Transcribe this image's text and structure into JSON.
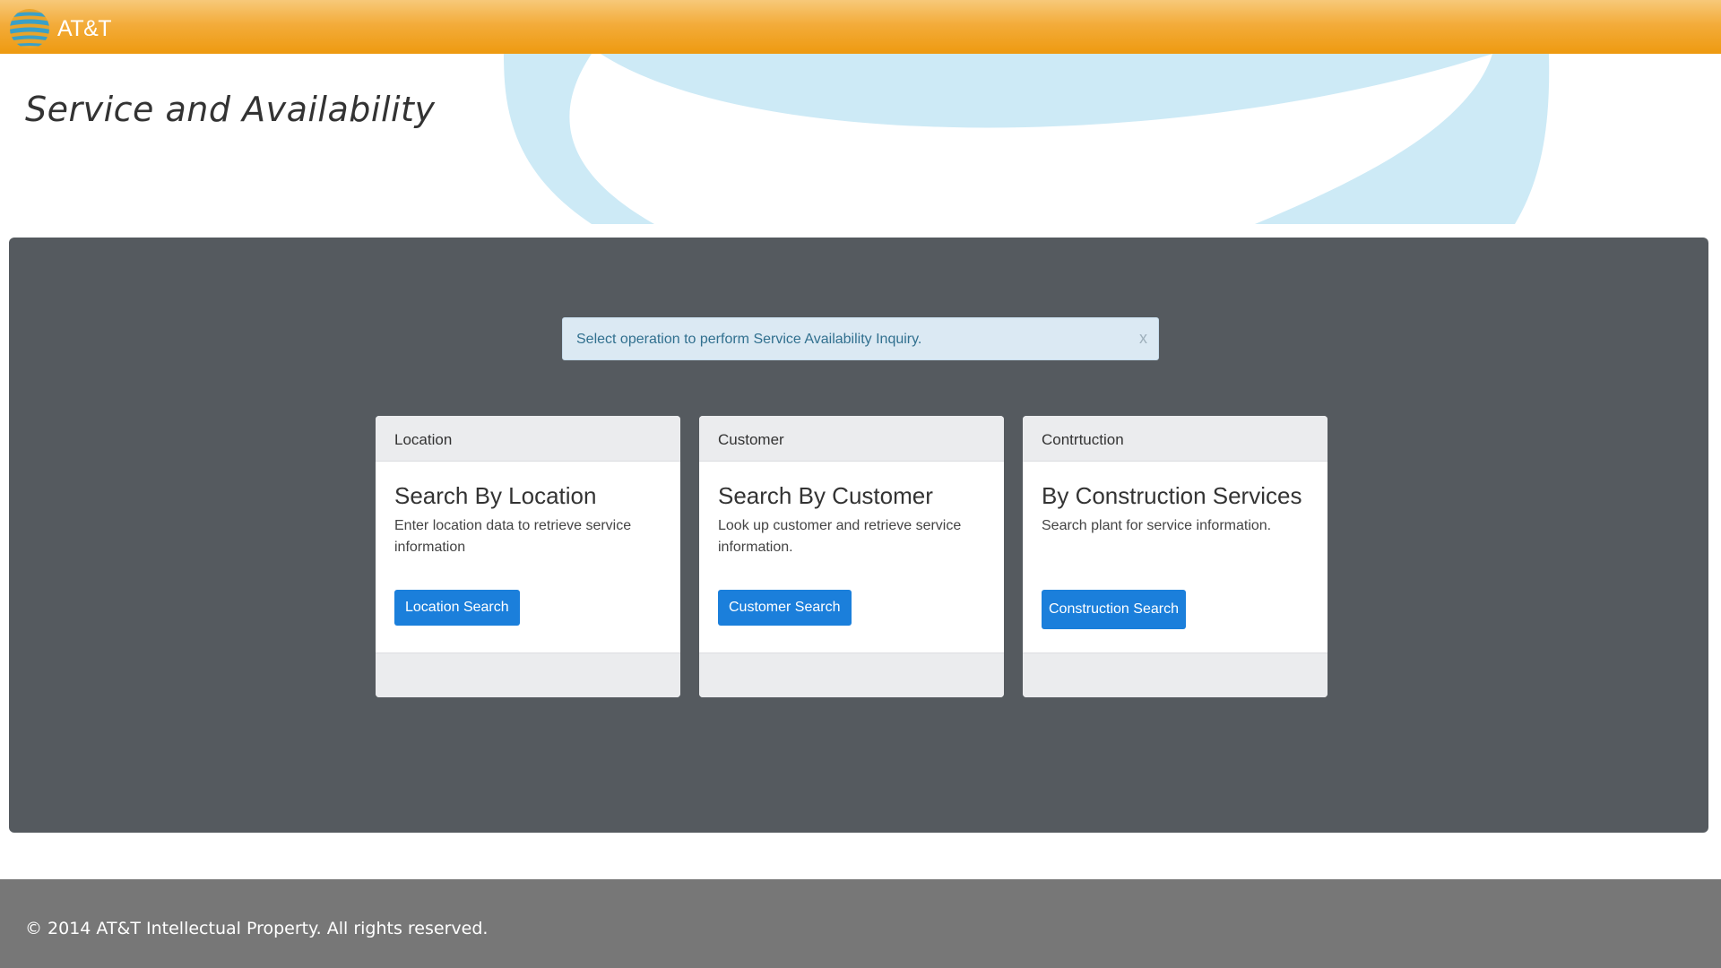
{
  "brand": {
    "logo_icon": "att-globe-icon",
    "name": "AT&T",
    "colors": {
      "orange": "#ee9a10",
      "globe_blue": "#cdeaf6",
      "panel": "#555a5f",
      "button": "#1b7fdb"
    }
  },
  "header": {
    "title": "Service and Availability"
  },
  "alert": {
    "message": "Select operation to perform Service Availability Inquiry.",
    "close_label": "x"
  },
  "cards": [
    {
      "header": "Location",
      "title": "Search By Location",
      "description": "Enter location data to retrieve service information",
      "button_label": "Location Search"
    },
    {
      "header": "Customer",
      "title": "Search By Customer",
      "description": "Look up customer and retrieve service information.",
      "button_label": "Customer Search"
    },
    {
      "header": "Contrtuction",
      "title": "By Construction Services",
      "description": "Search plant for service information.",
      "button_label": "Construction Search"
    }
  ],
  "footer": {
    "copyright": "© 2014 AT&T Intellectual Property. All rights reserved."
  }
}
